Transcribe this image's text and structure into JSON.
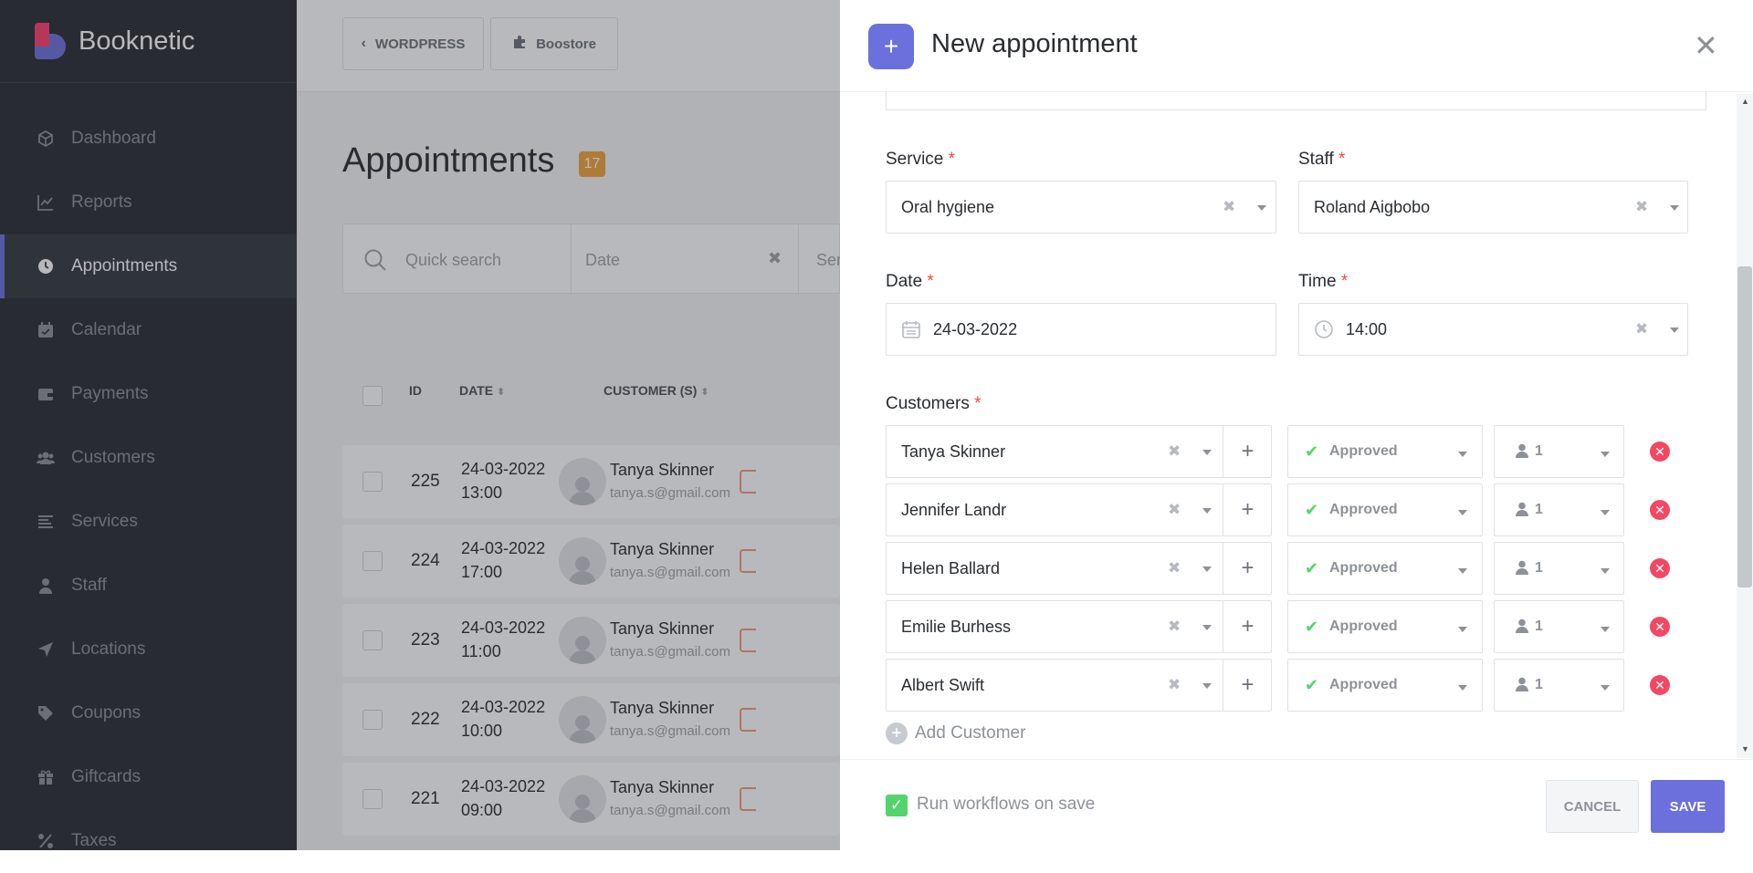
{
  "brand": {
    "name": "Booknetic"
  },
  "sidebar": {
    "items": [
      {
        "label": "Dashboard",
        "icon": "cube-icon"
      },
      {
        "label": "Reports",
        "icon": "chart-line-icon"
      },
      {
        "label": "Appointments",
        "icon": "clock-icon",
        "active": true
      },
      {
        "label": "Calendar",
        "icon": "calendar-icon"
      },
      {
        "label": "Payments",
        "icon": "wallet-icon"
      },
      {
        "label": "Customers",
        "icon": "users-icon"
      },
      {
        "label": "Services",
        "icon": "list-icon"
      },
      {
        "label": "Staff",
        "icon": "user-icon"
      },
      {
        "label": "Locations",
        "icon": "location-arrow-icon"
      },
      {
        "label": "Coupons",
        "icon": "tag-icon"
      },
      {
        "label": "Giftcards",
        "icon": "gift-icon"
      },
      {
        "label": "Taxes",
        "icon": "percent-icon"
      }
    ]
  },
  "topbar": {
    "wordpress_label": "WORDPRESS",
    "boostore_label": "Boostore"
  },
  "page": {
    "title": "Appointments",
    "count": "17"
  },
  "filters": {
    "search_placeholder": "Quick search",
    "date_placeholder": "Date",
    "service_placeholder": "Ser"
  },
  "table": {
    "headers": {
      "id": "ID",
      "date": "DATE",
      "customer": "CUSTOMER (S)"
    },
    "rows": [
      {
        "id": "225",
        "date": "24-03-2022",
        "time": "13:00",
        "name": "Tanya Skinner",
        "email": "tanya.s@gmail.com"
      },
      {
        "id": "224",
        "date": "24-03-2022",
        "time": "17:00",
        "name": "Tanya Skinner",
        "email": "tanya.s@gmail.com"
      },
      {
        "id": "223",
        "date": "24-03-2022",
        "time": "11:00",
        "name": "Tanya Skinner",
        "email": "tanya.s@gmail.com"
      },
      {
        "id": "222",
        "date": "24-03-2022",
        "time": "10:00",
        "name": "Tanya Skinner",
        "email": "tanya.s@gmail.com"
      },
      {
        "id": "221",
        "date": "24-03-2022",
        "time": "09:00",
        "name": "Tanya Skinner",
        "email": "tanya.s@gmail.com"
      }
    ]
  },
  "modal": {
    "title": "New appointment",
    "service": {
      "label": "Service",
      "value": "Oral hygiene"
    },
    "staff": {
      "label": "Staff",
      "value": "Roland Aigbobo"
    },
    "date": {
      "label": "Date",
      "value": "24-03-2022"
    },
    "time": {
      "label": "Time",
      "value": "14:00"
    },
    "customers_label": "Customers",
    "required_mark": "*",
    "customers": [
      {
        "name": "Tanya Skinner",
        "status": "Approved",
        "count": "1"
      },
      {
        "name": "Jennifer Landr",
        "status": "Approved",
        "count": "1"
      },
      {
        "name": "Helen Ballard",
        "status": "Approved",
        "count": "1"
      },
      {
        "name": "Emilie Burhess",
        "status": "Approved",
        "count": "1"
      },
      {
        "name": "Albert Swift",
        "status": "Approved",
        "count": "1"
      }
    ],
    "add_customer_label": "Add Customer",
    "workflows_label": "Run workflows on save",
    "cancel_label": "CANCEL",
    "save_label": "SAVE"
  },
  "colors": {
    "accent": "#6c70dc",
    "brand_pink": "#fb3e6e",
    "sidebar_bg": "#292d32",
    "approved_green": "#53d56c",
    "remove_red": "#f24863",
    "badge_orange": "#f2a33b"
  }
}
